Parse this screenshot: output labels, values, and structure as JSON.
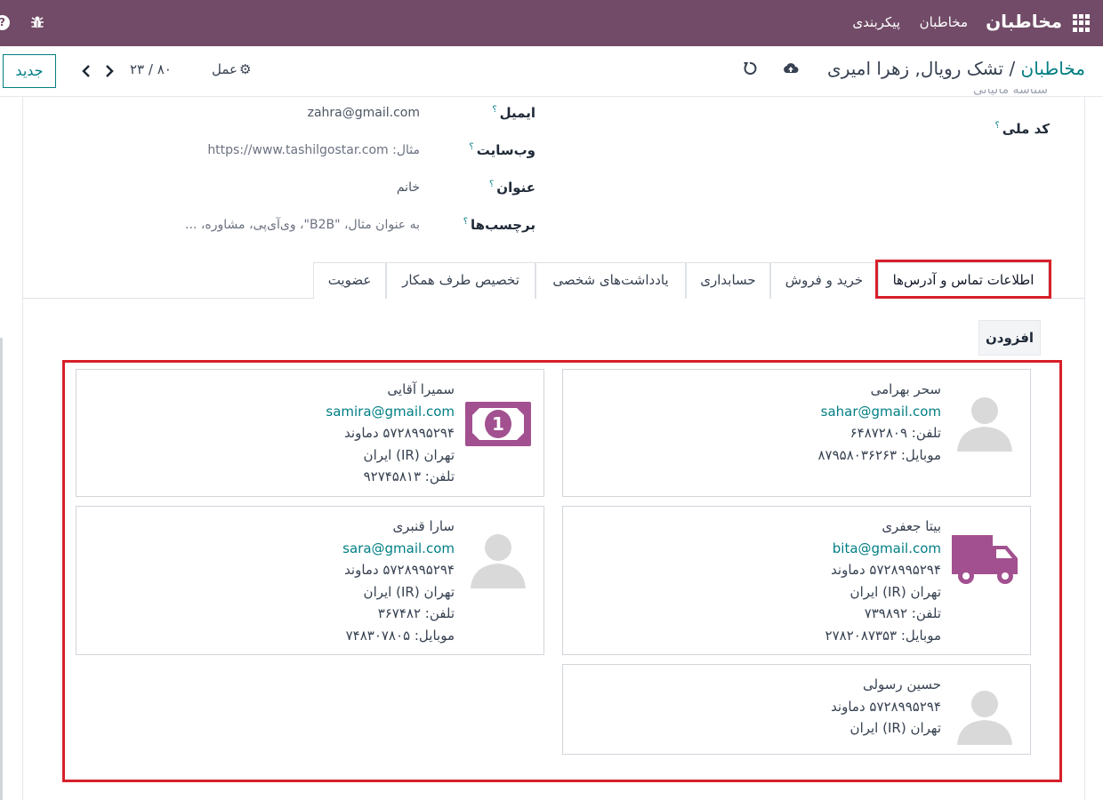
{
  "topbar": {
    "brand": "مخاطبان",
    "menu_contacts": "مخاطبان",
    "menu_config": "پیکربندی",
    "help_glyph": "?"
  },
  "control": {
    "new_button": "جدید",
    "pager": "۲۳ / ۸۰",
    "action_label": "عمل",
    "breadcrumb_parent": "مخاطبان",
    "breadcrumb_sep": " / ",
    "breadcrumb_current": "تشک رویال, زهرا امیری"
  },
  "form": {
    "cutoff_text": "شناسه مالیاتی",
    "national_id_label": "کد ملی",
    "email_label": "ایمیل",
    "email_value": "zahra@gmail.com",
    "website_label": "وب‌سایت",
    "website_placeholder": "مثال: https://www.tashilgostar.com",
    "title_label": "عنوان",
    "title_value": "خانم",
    "tags_label": "برچسب‌ها",
    "tags_placeholder": "به عنوان مثال، \"B2B\"، وی‌آی‌پی، مشاوره، ...",
    "help_mark": "؟"
  },
  "tabs": [
    {
      "label": "اطلاعات تماس و آدرس‌ها",
      "active": true
    },
    {
      "label": "خرید و فروش"
    },
    {
      "label": "حسابداری"
    },
    {
      "label": "یادداشت‌های شخصی"
    },
    {
      "label": "تخصیص طرف همکار"
    },
    {
      "label": "عضویت"
    }
  ],
  "add_button": "افزودن",
  "contacts": [
    {
      "name": "سحر بهرامی",
      "email": "sahar@gmail.com",
      "l3": "تلفن: ۶۴۸۷۲۸۰۹",
      "l4": "موبایل: ۸۷۹۵۸۰۳۶۲۶۳",
      "icon": "avatar-icon"
    },
    {
      "name": "سمیرا آقایی",
      "email": "samira@gmail.com",
      "l3": "۵۷۲۸۹۹۵۲۹۴ دماوند",
      "l4": "تهران (IR) ایران",
      "l5": "تلفن: ۹۲۷۴۵۸۱۳",
      "icon": "invoice-money-icon"
    },
    {
      "name": "بیتا جعفری",
      "email": "bita@gmail.com",
      "l3": "۵۷۲۸۹۹۵۲۹۴ دماوند",
      "l4": "تهران (IR) ایران",
      "l5": "تلفن: ۷۳۹۸۹۲",
      "l6": "موبایل: ۲۷۸۲۰۸۷۳۵۳",
      "icon": "delivery-truck-icon"
    },
    {
      "name": "سارا قنبری",
      "email": "sara@gmail.com",
      "l3": "۵۷۲۸۹۹۵۲۹۴ دماوند",
      "l4": "تهران (IR) ایران",
      "l5": "تلفن: ۳۶۷۴۸۲",
      "l6": "موبایل: ۷۴۸۳۰۷۸۰۵",
      "icon": "avatar-icon"
    },
    {
      "name": "حسین رسولی",
      "l2": "۵۷۲۸۹۹۵۲۹۴ دماوند",
      "l3": "تهران (IR) ایران",
      "icon": "avatar-icon"
    }
  ],
  "colors": {
    "brand": "#714b67",
    "accent": "#017e84",
    "highlight": "#d71f2a",
    "icon_purple": "#a2508f",
    "avatar_gray": "#d9d9d9"
  }
}
